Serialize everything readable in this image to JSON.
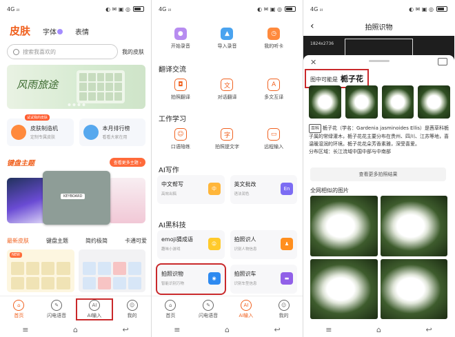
{
  "status": {
    "signal": "4G ᵢₗₗ",
    "icons": "◐ ✉ ▣ ◎"
  },
  "sysnav": [
    "≡",
    "⌂",
    "↩"
  ],
  "panel1": {
    "tabs": {
      "skin": "皮肤",
      "font": "字体",
      "emoji": "表情"
    },
    "search_placeholder": "搜索我喜欢的",
    "my_skin": "我的皮肤",
    "banner_title": "风雨旅途",
    "card_left": {
      "title": "皮肤制造机",
      "sub": "定制专属皮肤",
      "flag": "试试我的皮肤"
    },
    "card_right": {
      "title": "本月排行榜",
      "sub": "看看大家在用"
    },
    "theme_title": "键盘主题",
    "theme_more": "查看更多主题 ›",
    "theme_label": "KEYBOARD",
    "subtabs": [
      "最新皮肤",
      "键盘主题",
      "简约极简",
      "卡通可爱"
    ],
    "new_tag": "NEW",
    "tabbar": [
      {
        "label": "首页",
        "icon": "⌂"
      },
      {
        "label": "闪电语音",
        "icon": "✎"
      },
      {
        "label": "AI输入",
        "icon": "AI"
      },
      {
        "label": "我的",
        "icon": "☺"
      }
    ]
  },
  "panel2": {
    "top_features": [
      {
        "label": "开始录音",
        "icon": "●",
        "color": "#b78cf0"
      },
      {
        "label": "导入录音",
        "icon": "▲",
        "color": "#4aa3ef"
      },
      {
        "label": "我的听卡",
        "icon": "◷",
        "color": "#ff8a3d"
      }
    ],
    "section_translate": "翻译交流",
    "translate_features": [
      {
        "label": "拍照翻译",
        "icon": "◘"
      },
      {
        "label": "对话翻译",
        "icon": "文"
      },
      {
        "label": "多文互译",
        "icon": "A"
      }
    ],
    "section_work": "工作学习",
    "work_features": [
      {
        "label": "口语陪练",
        "icon": "☺"
      },
      {
        "label": "拍照提文字",
        "icon": "字"
      },
      {
        "label": "远程输入",
        "icon": "▭"
      }
    ],
    "section_write": "AI写作",
    "write_cards": [
      {
        "title": "中文帮写",
        "sub": "高效出稿",
        "icon": "中",
        "color": "#ffb63a"
      },
      {
        "title": "英文批改",
        "sub": "语法润色",
        "icon": "En",
        "color": "#7c6cf3"
      }
    ],
    "section_tech": "AI黑科技",
    "tech_row1": [
      {
        "title": "emoji猜成语",
        "sub": "趣味小游戏",
        "icon": "😜",
        "color": "#ffca2b"
      },
      {
        "title": "拍照识人",
        "sub": "识别人物信息",
        "icon": "♟",
        "color": "#ff8f1f"
      }
    ],
    "tech_row2": [
      {
        "title": "拍照识物",
        "sub": "智能识别万物",
        "icon": "◉",
        "color": "#2e8af0"
      },
      {
        "title": "拍照识车",
        "sub": "识别车型信息",
        "icon": "▬",
        "color": "#9160e8"
      }
    ],
    "tabbar": [
      {
        "label": "首页",
        "icon": "⌂"
      },
      {
        "label": "闪电语音",
        "icon": "✎"
      },
      {
        "label": "AI输入",
        "icon": "AI"
      },
      {
        "label": "我的",
        "icon": "☺"
      }
    ]
  },
  "panel3": {
    "title": "拍照识物",
    "back": "‹",
    "resolution": "1824x2736",
    "possible_label": "图中可能是",
    "possible_name": "栀子花",
    "desc_tag": "百科",
    "description": "栀子花（学名：Gardenia jasminoides Ellis）是茜草科栀子属的常绿灌木，栀子花花主要分布在贵州、四川、江苏等地，喜温暖湿润的环境。栀子花花朵芳香素雅，深受喜爱。",
    "distribution": "分布区域：长江流域中国中部与中南部",
    "more_button": "查看更多拍照结果",
    "similar_title": "全网相似的图片"
  }
}
